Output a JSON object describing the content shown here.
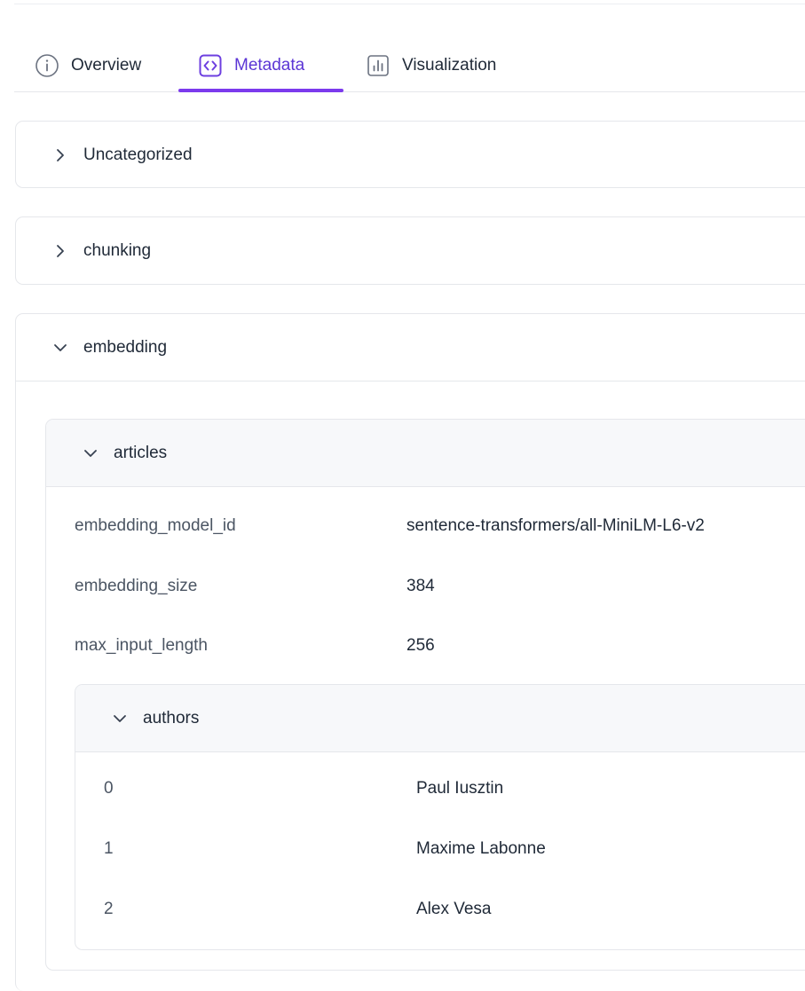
{
  "tabs": [
    {
      "label": "Overview",
      "icon": "info-circle-icon"
    },
    {
      "label": "Metadata",
      "icon": "code-brackets-icon"
    },
    {
      "label": "Visualization",
      "icon": "bar-chart-icon"
    }
  ],
  "active_tab": "Metadata",
  "colors": {
    "accent": "#7c3aed",
    "accent_text": "#5b35d5",
    "border": "#e5e7eb",
    "muted_text": "#4b5563"
  },
  "sections": {
    "uncategorized": {
      "label": "Uncategorized",
      "icon": "chevron-right-icon"
    },
    "chunking": {
      "label": "chunking",
      "icon": "chevron-right-icon"
    },
    "embedding": {
      "label": "embedding",
      "icon": "chevron-down-icon",
      "articles": {
        "label": "articles",
        "icon": "chevron-down-icon",
        "fields": [
          {
            "key": "embedding_model_id",
            "value": "sentence-transformers/all-MiniLM-L6-v2"
          },
          {
            "key": "embedding_size",
            "value": "384"
          },
          {
            "key": "max_input_length",
            "value": "256"
          }
        ],
        "authors": {
          "label": "authors",
          "icon": "chevron-down-icon",
          "items": [
            {
              "index": "0",
              "name": "Paul Iusztin"
            },
            {
              "index": "1",
              "name": "Maxime Labonne"
            },
            {
              "index": "2",
              "name": "Alex Vesa"
            }
          ]
        }
      }
    }
  }
}
